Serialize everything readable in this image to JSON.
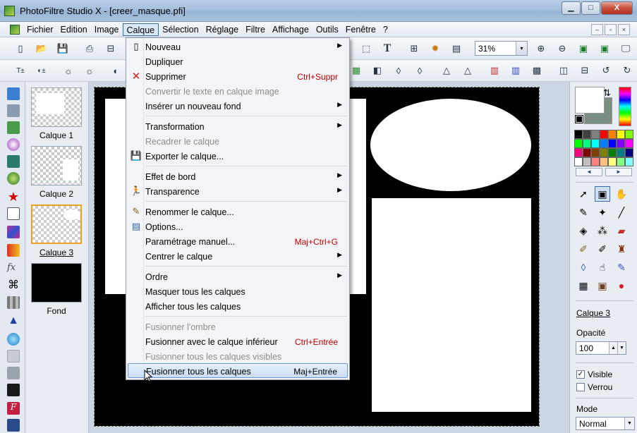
{
  "window": {
    "title": "PhotoFiltre Studio X - [creer_masque.pfi]",
    "buttons": {
      "minimize": "▁",
      "maximize": "□",
      "close": "X"
    }
  },
  "menubar": {
    "items": [
      "Fichier",
      "Edition",
      "Image",
      "Calque",
      "Sélection",
      "Réglage",
      "Filtre",
      "Affichage",
      "Outils",
      "Fenêtre",
      "?"
    ],
    "active": "Calque",
    "mdi_buttons": [
      "–",
      "▫",
      "×"
    ]
  },
  "toolbar": {
    "zoom_value": "31%",
    "zoom_arrow": "▾"
  },
  "layers": [
    {
      "label": "Calque 1"
    },
    {
      "label": "Calque 2"
    },
    {
      "label": "Calque 3"
    },
    {
      "label": "Fond"
    }
  ],
  "calque_menu": {
    "items": [
      {
        "label": "Nouveau",
        "submenu": "▶",
        "icon": "new-page-icon"
      },
      {
        "label": "Dupliquer"
      },
      {
        "label": "Supprimer",
        "shortcut": "Ctrl+Suppr",
        "icon": "red-x-icon"
      },
      {
        "label": "Convertir le texte en calque image",
        "disabled": true
      },
      {
        "label": "Insérer un nouveau fond",
        "submenu": "▶"
      },
      {
        "label": "Transformation",
        "submenu": "▶"
      },
      {
        "label": "Recadrer le calque",
        "disabled": true
      },
      {
        "label": "Exporter le calque...",
        "icon": "save-icon"
      },
      {
        "label": "Effet de bord",
        "submenu": "▶"
      },
      {
        "label": "Transparence",
        "submenu": "▶",
        "icon": "transparency-icon"
      },
      {
        "label": "Renommer le calque...",
        "icon": "rename-icon"
      },
      {
        "label": "Options...",
        "icon": "options-icon"
      },
      {
        "label": "Paramétrage manuel...",
        "shortcut": "Maj+Ctrl+G"
      },
      {
        "label": "Centrer le calque",
        "submenu": "▶"
      },
      {
        "label": "Ordre",
        "submenu": "▶"
      },
      {
        "label": "Masquer tous les calques"
      },
      {
        "label": "Afficher tous les calques"
      },
      {
        "label": "Fusionner l'ombre",
        "disabled": true
      },
      {
        "label": "Fusionner avec le calque inférieur",
        "shortcut": "Ctrl+Entrée"
      },
      {
        "label": "Fusionner tous les calques visibles",
        "disabled": true
      },
      {
        "label": "Fusionner tous les calques",
        "shortcut": "Maj+Entrée",
        "highlighted": true
      }
    ]
  },
  "right_panel": {
    "layer_name": "Calque 3",
    "opacity_label": "Opacité",
    "opacity_value": "100",
    "visible_label": "Visible",
    "visible_checked": true,
    "lock_label": "Verrou",
    "lock_checked": false,
    "mode_label": "Mode",
    "mode_value": "Normal",
    "palette_nav": [
      "◄",
      "►"
    ],
    "colors": {
      "foreground": "#ffffff",
      "background": "#7a8f82",
      "palette": [
        "#000000",
        "#404040",
        "#808080",
        "#ff0000",
        "#ff8000",
        "#ffff00",
        "#80ff00",
        "#00ff00",
        "#00ff80",
        "#00ffff",
        "#0080ff",
        "#0000ff",
        "#8000ff",
        "#ff00ff",
        "#ff0080",
        "#800000",
        "#804000",
        "#808000",
        "#008000",
        "#008080",
        "#000080",
        "#ffffff",
        "#c0c0c0",
        "#ff8080",
        "#ffc080",
        "#ffff80",
        "#80ff80",
        "#80ffff"
      ]
    }
  },
  "accent": "#3b6ea5",
  "highlight_border": "#f0a020"
}
